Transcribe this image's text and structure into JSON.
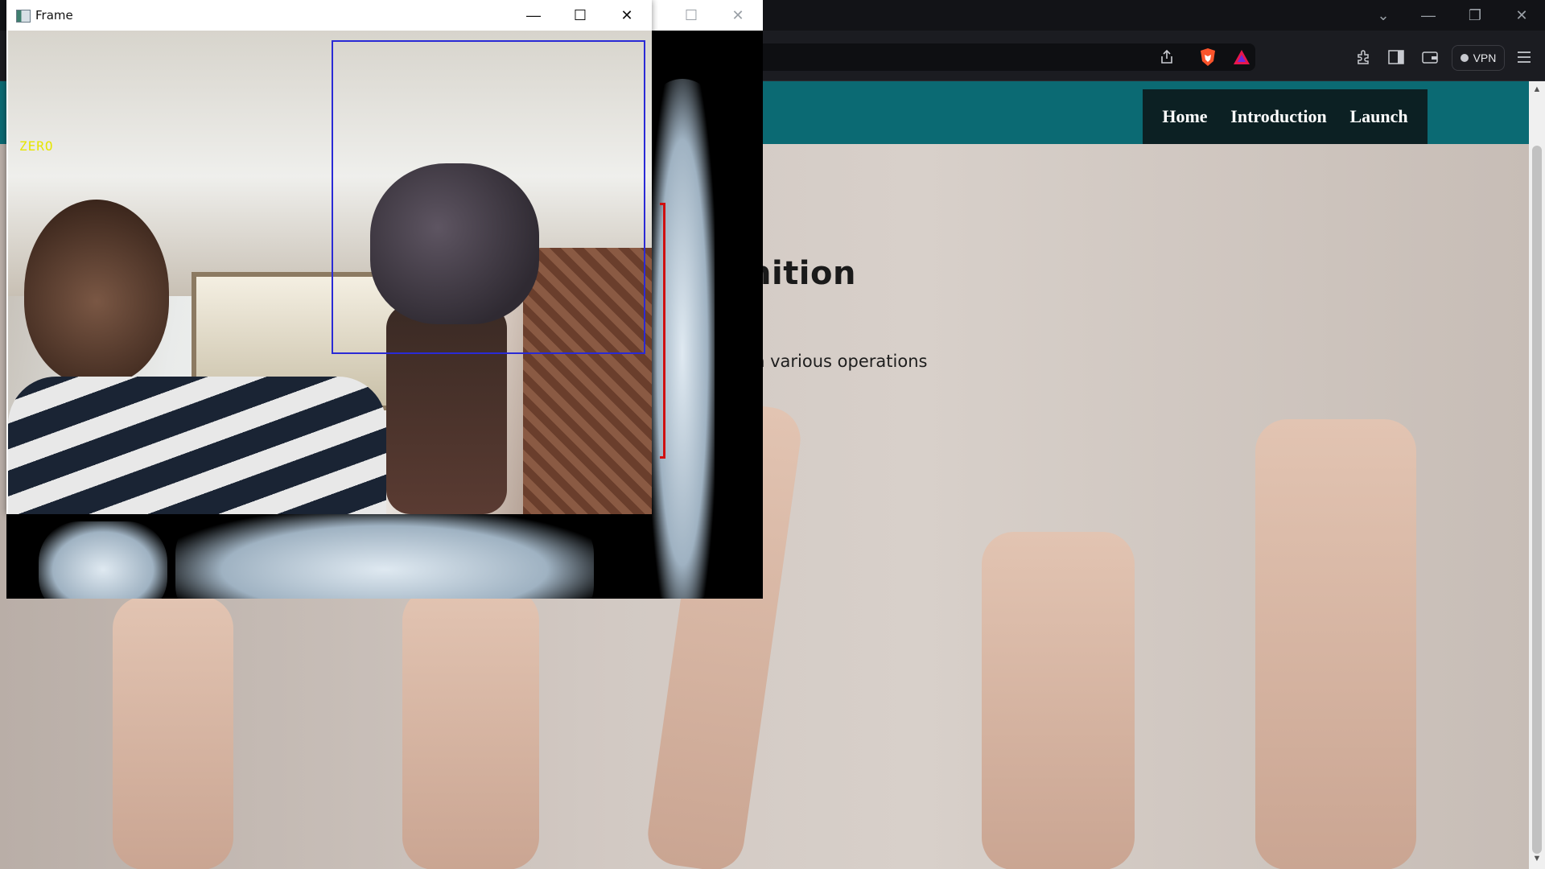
{
  "frame_window": {
    "title": "Frame",
    "minimize_glyph": "—",
    "maximize_glyph": "☐",
    "close_glyph": "✕",
    "gesture_label": "ZERO",
    "roi_color": "#2a2ad6",
    "label_color": "#e6e600"
  },
  "background_window": {
    "maximize_glyph": "☐",
    "close_glyph": "✕"
  },
  "browser": {
    "window_controls": {
      "dropdown": "⌄",
      "minimize": "—",
      "restore": "❐",
      "close": "✕"
    },
    "toolbar": {
      "share_icon": "share-icon",
      "brave_icon": "brave-shield-icon",
      "rewards_icon": "brave-rewards-icon",
      "extensions_icon": "extensions-icon",
      "sidebar_icon": "sidebar-icon",
      "wallet_icon": "wallet-icon",
      "vpn_label": "VPN",
      "menu_icon": "menu-icon"
    }
  },
  "site": {
    "nav": [
      "Home",
      "Introduction",
      "Launch"
    ],
    "header_color": "#0b6a73",
    "nav_bg": "#0c2023",
    "hero_title_visible": "nition",
    "hero_subtitle_visible": "m various operations"
  }
}
